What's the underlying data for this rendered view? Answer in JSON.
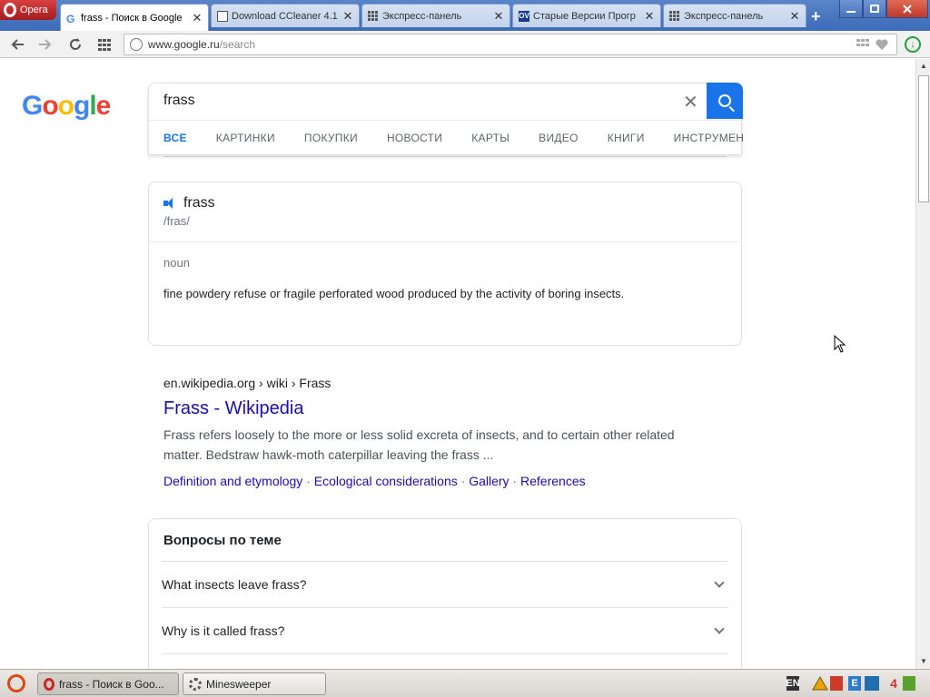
{
  "browser": {
    "menu_label": "Opera",
    "tabs": [
      {
        "title": "frass - Поиск в Google",
        "icon": "google-g-icon",
        "active": true
      },
      {
        "title": "Download CCleaner 4.1",
        "icon": "document-icon",
        "active": false
      },
      {
        "title": "Экспресс-панель",
        "icon": "speed-dial-icon",
        "active": false
      },
      {
        "title": "Старые Версии Прогр",
        "icon": "ov-icon",
        "active": false
      },
      {
        "title": "Экспресс-панель",
        "icon": "speed-dial-icon",
        "active": false
      }
    ],
    "tab_close_glyph": "✕",
    "new_tab_glyph": "+",
    "ov_badge": "OV",
    "g_badge": "G",
    "address": {
      "host": "www.google.ru",
      "path": "/search"
    }
  },
  "google": {
    "logo_letters": [
      {
        "ch": "G",
        "color": "#4285F4"
      },
      {
        "ch": "o",
        "color": "#EA4335"
      },
      {
        "ch": "o",
        "color": "#FBBC05"
      },
      {
        "ch": "g",
        "color": "#4285F4"
      },
      {
        "ch": "l",
        "color": "#34A853"
      },
      {
        "ch": "e",
        "color": "#EA4335"
      }
    ],
    "query": "frass",
    "clear_glyph": "✕",
    "tabs": [
      "ВСЕ",
      "КАРТИНКИ",
      "ПОКУПКИ",
      "НОВОСТИ",
      "КАРТЫ",
      "ВИДЕО",
      "КНИГИ",
      "ИНСТРУМЕНТЫ"
    ]
  },
  "dictionary": {
    "word": "frass",
    "phonetic": "/fras/",
    "part_of_speech": "noun",
    "definition": "fine powdery refuse or fragile perforated wood produced by the activity of boring insects."
  },
  "result": {
    "cite": "en.wikipedia.org › wiki › Frass",
    "title": "Frass - Wikipedia",
    "snippet": "Frass refers loosely to the more or less solid excreta of insects, and to certain other related matter. Bedstraw hawk-moth caterpillar leaving the frass ...",
    "sitelinks": [
      "Definition and etymology",
      "Ecological considerations",
      "Gallery",
      "References"
    ],
    "sitelink_separator": " · "
  },
  "paa": {
    "heading": "Вопросы по теме",
    "questions": [
      "What insects leave frass?",
      "Why is it called frass?"
    ]
  },
  "taskbar": {
    "tasks": [
      {
        "title": "frass - Поиск в Goo...",
        "icon": "opera-icon"
      },
      {
        "title": "Minesweeper",
        "icon": "minesweeper-icon"
      }
    ],
    "tray": {
      "keyboard": "EN",
      "clock": "4"
    }
  },
  "colors": {
    "link": "#1a0dab",
    "accent": "#1a73e8",
    "tabbar": "#3d6bb8"
  }
}
